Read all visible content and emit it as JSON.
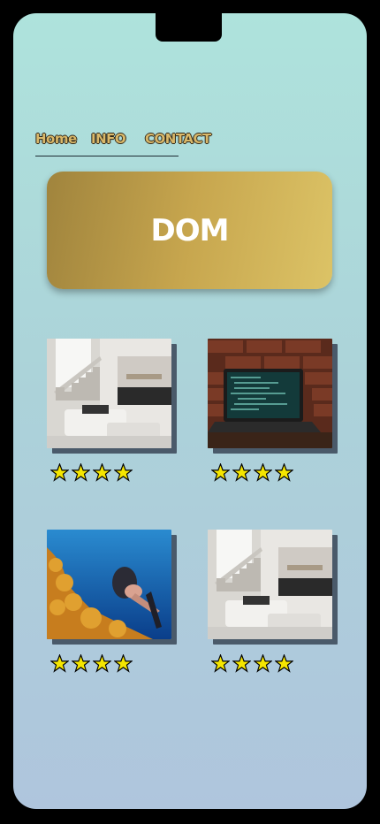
{
  "nav": {
    "home": "Home",
    "info": "INFO",
    "contact": "CONTACT"
  },
  "hero": {
    "title": "DOM"
  },
  "cards": [
    {
      "image": "living-room-interior",
      "rating": 4
    },
    {
      "image": "laptop-code-brick-wall",
      "rating": 4
    },
    {
      "image": "diver-coral-reef",
      "rating": 4
    },
    {
      "image": "living-room-interior",
      "rating": 4
    }
  ],
  "colors": {
    "star": "#f5e600",
    "hero_start": "#a0843d",
    "hero_end": "#dcc366",
    "nav_text": "#d9b86a"
  }
}
